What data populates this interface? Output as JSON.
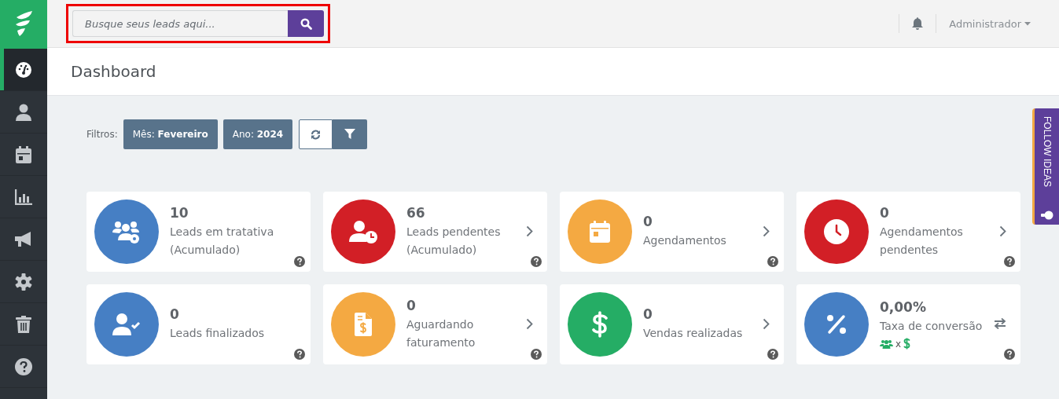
{
  "sidebar": {
    "items": [
      {
        "kind": "dashboard",
        "selected": true
      },
      {
        "kind": "user",
        "selected": false
      },
      {
        "kind": "calendar",
        "selected": false
      },
      {
        "kind": "chart",
        "selected": false
      },
      {
        "kind": "megaphone",
        "selected": false
      },
      {
        "kind": "gear",
        "selected": false
      },
      {
        "kind": "trash",
        "selected": false
      },
      {
        "kind": "help",
        "selected": false
      }
    ]
  },
  "search": {
    "placeholder": "Busque seus leads aqui...",
    "highlighted": true
  },
  "user_menu": {
    "label": "Administrador"
  },
  "page_title": "Dashboard",
  "filters": {
    "label": "Filtros:",
    "chips": [
      {
        "label": "Mês:",
        "value": "Fevereiro"
      },
      {
        "label": "Ano:",
        "value": "2024"
      }
    ]
  },
  "cards": [
    {
      "kind": "users-gear",
      "value": "10",
      "label": "Leads em tratativa (Acumulado)",
      "color": "#467fc4"
    },
    {
      "kind": "user-clock",
      "value": "66",
      "label": "Leads pendentes (Acumulado)",
      "color": "#d21f26",
      "action": {
        "kind": "chevron"
      }
    },
    {
      "kind": "calendar",
      "value": "0",
      "label": "Agendamentos",
      "color": "#f4a942",
      "action": {
        "kind": "chevron"
      }
    },
    {
      "kind": "clock",
      "value": "0",
      "label": "Agendamentos pendentes",
      "color": "#d21f26",
      "action": {
        "kind": "chevron"
      }
    },
    {
      "kind": "user-check",
      "value": "0",
      "label": "Leads finalizados",
      "color": "#467fc4"
    },
    {
      "kind": "invoice",
      "value": "0",
      "label": "Aguardando faturamento",
      "color": "#f4a942",
      "action": {
        "kind": "chevron"
      }
    },
    {
      "kind": "dollar",
      "value": "0",
      "label": "Vendas realizadas",
      "color": "#25ad65",
      "action": {
        "kind": "chevron"
      }
    },
    {
      "kind": "percent",
      "value": "0,00%",
      "label": "Taxa de conversão",
      "color": "#467fc4",
      "action": {
        "kind": "swap"
      },
      "sub_text": "x"
    }
  ],
  "side_tab": {
    "label": "FOLLOW IDEAS"
  }
}
